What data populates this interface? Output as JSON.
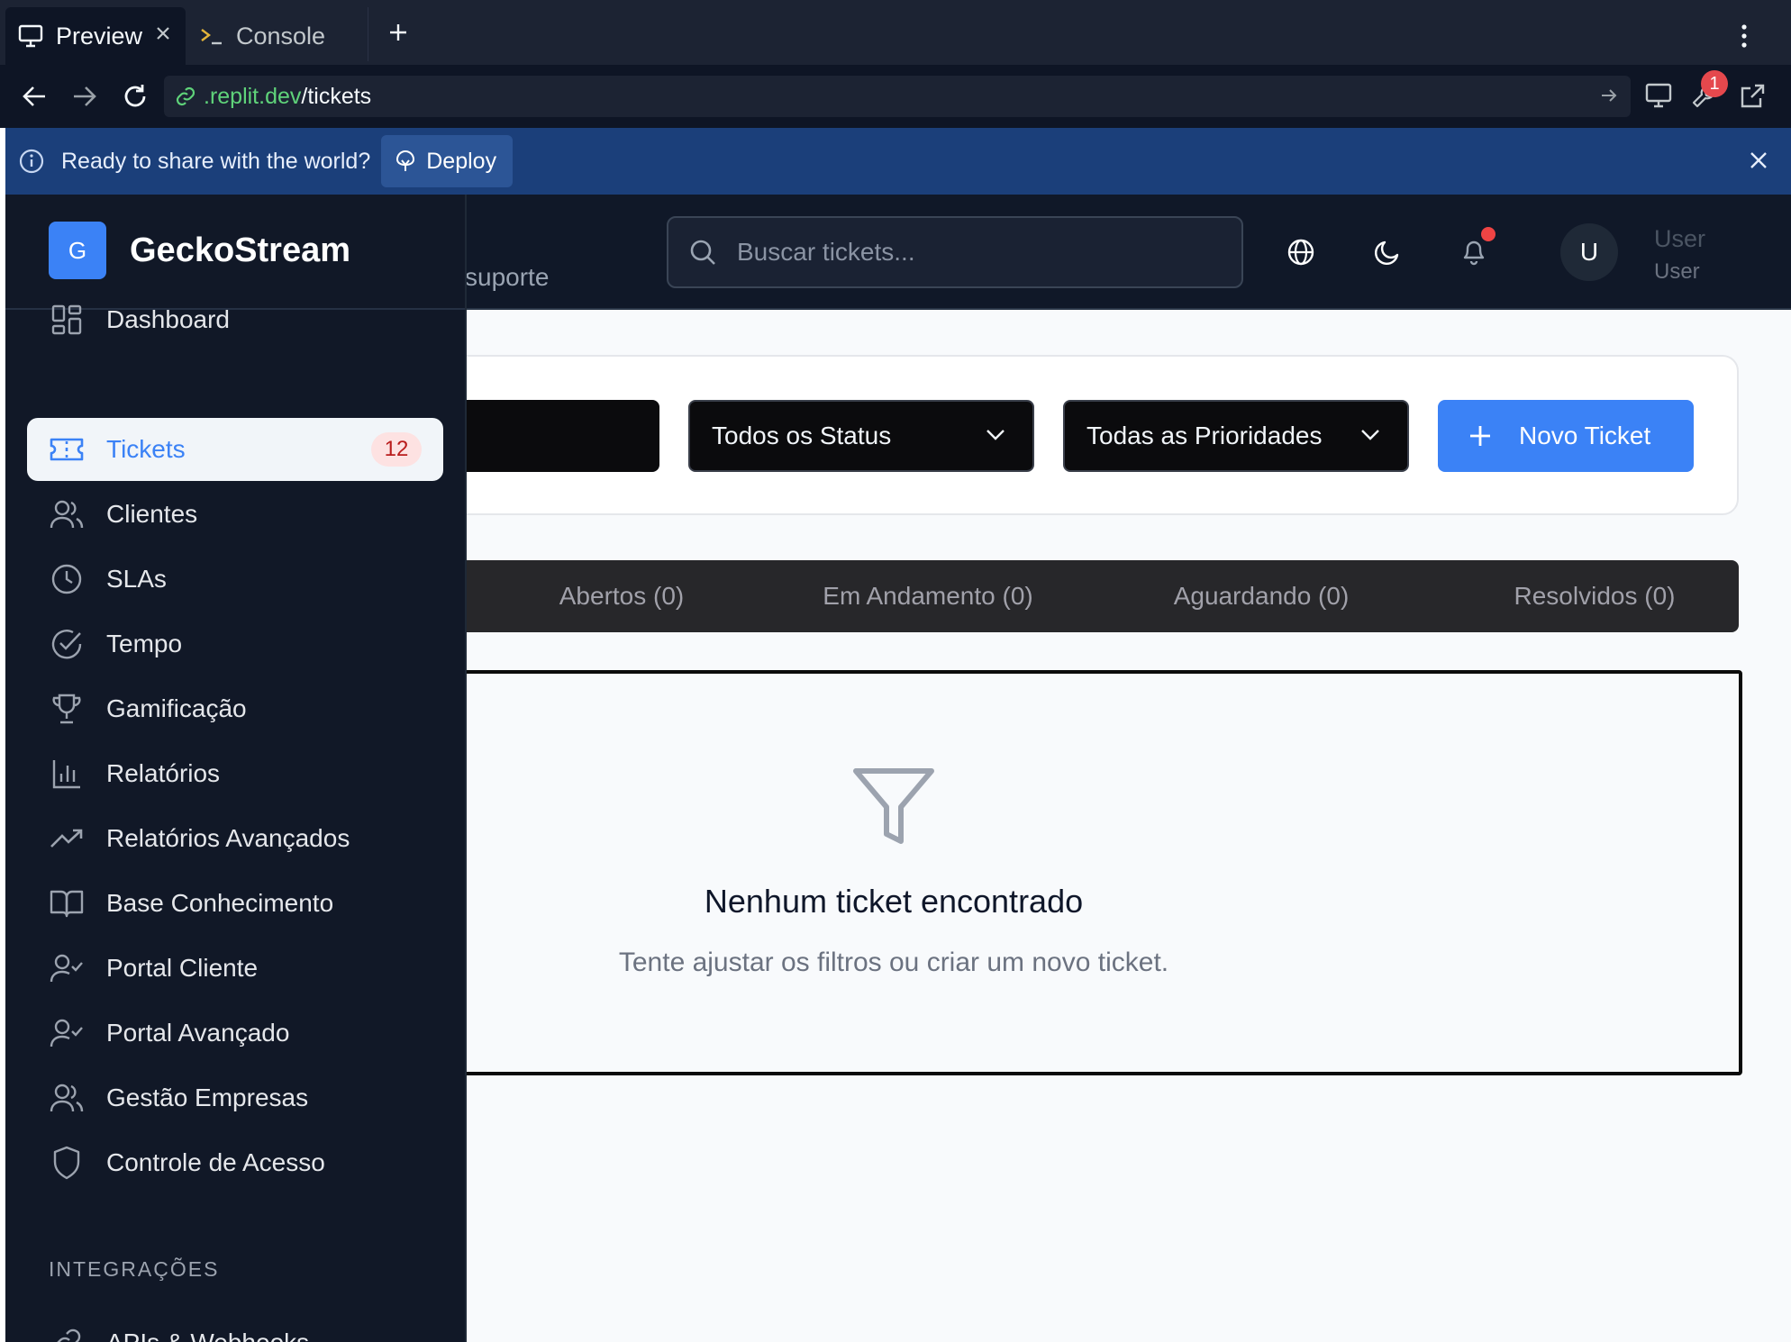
{
  "browser": {
    "tabs": [
      {
        "label": "Preview",
        "icon": "monitor-icon",
        "active": true
      },
      {
        "label": "Console",
        "icon": "terminal-icon",
        "active": false
      }
    ],
    "url": {
      "domain": ".replit.dev",
      "path": "/tickets"
    },
    "tools_badge": "1",
    "banner": {
      "text": "Ready to share with the world?",
      "deploy_label": "Deploy"
    }
  },
  "header": {
    "subtitle_fragment": "suporte",
    "search_placeholder": "Buscar tickets...",
    "user": {
      "initial": "U",
      "name": "User",
      "role": "User"
    }
  },
  "sidebar": {
    "brand": {
      "logo_letter": "G",
      "name": "GeckoStream"
    },
    "items": [
      {
        "label": "Dashboard",
        "icon": "dashboard-grid-icon"
      },
      {
        "label": "Tickets",
        "icon": "ticket-icon",
        "badge": "12",
        "active": true
      },
      {
        "label": "Clientes",
        "icon": "users-icon"
      },
      {
        "label": "SLAs",
        "icon": "clock-icon"
      },
      {
        "label": "Tempo",
        "icon": "check-circle-icon"
      },
      {
        "label": "Gamificação",
        "icon": "trophy-icon"
      },
      {
        "label": "Relatórios",
        "icon": "bar-chart-icon"
      },
      {
        "label": "Relatórios Avançados",
        "icon": "trending-up-icon"
      },
      {
        "label": "Base Conhecimento",
        "icon": "book-icon"
      },
      {
        "label": "Portal Cliente",
        "icon": "user-check-icon"
      },
      {
        "label": "Portal Avançado",
        "icon": "user-check-icon"
      },
      {
        "label": "Gestão Empresas",
        "icon": "users-icon"
      },
      {
        "label": "Controle de Acesso",
        "icon": "shield-icon"
      }
    ],
    "section_integracoes": "INTEGRAÇÕES",
    "integration_items": [
      {
        "label": "APIs & Webhooks",
        "icon": "link-icon"
      }
    ]
  },
  "filters": {
    "status_select": "Todos os Status",
    "priority_select": "Todas as Prioridades",
    "new_ticket_label": "Novo Ticket"
  },
  "status_tabs": [
    {
      "label": "Abertos (0)"
    },
    {
      "label": "Em Andamento (0)"
    },
    {
      "label": "Aguardando (0)"
    },
    {
      "label": "Resolvidos (0)"
    }
  ],
  "empty_state": {
    "icon": "filter-icon",
    "title": "Nenhum ticket encontrado",
    "description": "Tente ajustar os filtros ou criar um novo ticket."
  },
  "colors": {
    "accent": "#3b82f6",
    "sidebar_bg": "#111827",
    "banner_bg": "#1b3f7a",
    "badge_red": "#ef4444"
  }
}
